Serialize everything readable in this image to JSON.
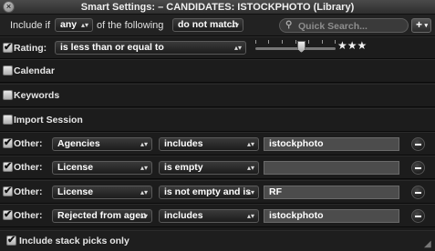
{
  "window": {
    "title": "Smart Settings:  – CANDIDATES: ISTOCKPHOTO (Library)"
  },
  "topbar": {
    "include_if_label": "Include if",
    "match_value": "any",
    "of_following_label": "of the following",
    "mode_value": "do not match",
    "search_placeholder": "Quick Search...",
    "add_label": "+"
  },
  "rating": {
    "label": "Rating:",
    "checked": true,
    "operator": "is less than or equal to",
    "stars": "★★★",
    "level": 3
  },
  "sections": [
    {
      "label": "Calendar",
      "checked": false
    },
    {
      "label": "Keywords",
      "checked": false
    },
    {
      "label": "Import Session",
      "checked": false
    }
  ],
  "other_rows": [
    {
      "label": "Other:",
      "field": "Agencies",
      "operator": "includes",
      "value": "istockphoto"
    },
    {
      "label": "Other:",
      "field": "License",
      "operator": "is empty",
      "value": ""
    },
    {
      "label": "Other:",
      "field": "License",
      "operator": "is not empty and is",
      "value": "RF"
    },
    {
      "label": "Other:",
      "field": "Rejected from agen",
      "operator": "includes",
      "value": "istockphoto"
    }
  ],
  "footer": {
    "stack_picks_label": "Include stack picks only",
    "checked": true
  },
  "colors": {
    "background": "#1a1a1a",
    "row": "#1c1c1c",
    "field": "#4c4c4c",
    "text": "#e8e8e8"
  }
}
